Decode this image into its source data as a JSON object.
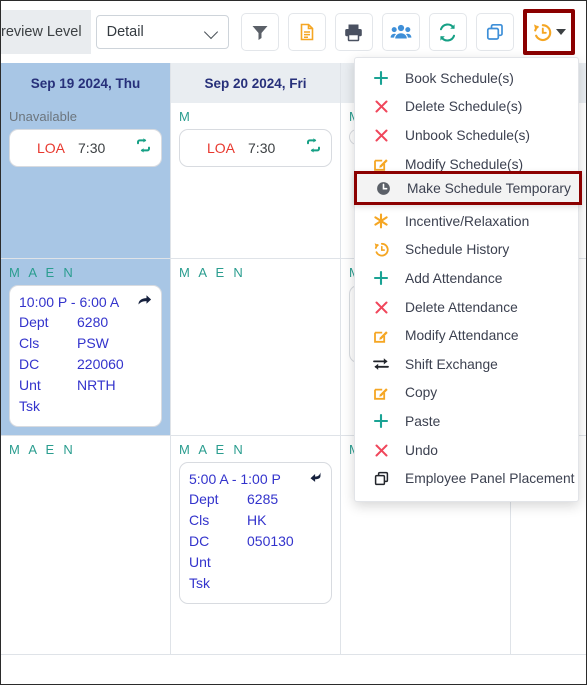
{
  "toolbar": {
    "level_label": "review Level",
    "select_value": "Detail",
    "buttons": [
      {
        "name": "filter-button",
        "icon": "filter-icon"
      },
      {
        "name": "report-button",
        "icon": "document-icon"
      },
      {
        "name": "print-button",
        "icon": "printer-icon"
      },
      {
        "name": "group-button",
        "icon": "people-icon"
      },
      {
        "name": "refresh-button",
        "icon": "refresh-icon"
      },
      {
        "name": "copy-panel-button",
        "icon": "copy-icon"
      },
      {
        "name": "schedule-actions-button",
        "icon": "clock-history-icon"
      }
    ]
  },
  "calendar": {
    "columns": [
      {
        "header": "Sep 19 2024, Thu",
        "selected": true
      },
      {
        "header": "Sep 20 2024, Fri",
        "selected": false
      },
      {
        "header": "",
        "selected": false
      },
      {
        "header": "",
        "selected": false
      }
    ],
    "rows": [
      {
        "cells": [
          {
            "tag": "Unavailable",
            "tag_style": "unavailable",
            "card": {
              "type": "loa",
              "code": "LOA",
              "hours": "7:30",
              "icon": "repeat-icon"
            }
          },
          {
            "tag": "M",
            "tag_style": "shift",
            "card": {
              "type": "loa",
              "code": "LOA",
              "hours": "7:30",
              "icon": "repeat-icon"
            }
          },
          {
            "tag": "M",
            "tag_style": "shift",
            "card": {
              "type": "loa",
              "code": "",
              "hours": "",
              "icon": ""
            }
          },
          {
            "tag": "",
            "tag_style": "shift",
            "card": null
          }
        ]
      },
      {
        "cells": [
          {
            "tag": "M A E N",
            "tag_style": "shift",
            "card": {
              "type": "shift",
              "time": "10:00 P - 6:00 A",
              "icon": "forward-arrow-icon",
              "fields": [
                {
                  "key": "Dept",
                  "value": "6280"
                },
                {
                  "key": "Cls",
                  "value": "PSW"
                },
                {
                  "key": "DC",
                  "value": "220060"
                },
                {
                  "key": "Unt",
                  "value": "NRTH"
                },
                {
                  "key": "Tsk",
                  "value": ""
                }
              ]
            }
          },
          {
            "tag": "M A E N",
            "tag_style": "shift",
            "card": null
          },
          {
            "tag": "M",
            "tag_style": "shift",
            "card": null
          },
          {
            "tag": "",
            "tag_style": "shift",
            "card": null
          }
        ]
      },
      {
        "cells": [
          {
            "tag": "M A E N",
            "tag_style": "shift",
            "card": null
          },
          {
            "tag": "M A E N",
            "tag_style": "shift",
            "card": {
              "type": "shift",
              "time": "5:00 A - 1:00 P",
              "icon": "back-arrow-icon",
              "fields": [
                {
                  "key": "Dept",
                  "value": "6285"
                },
                {
                  "key": "Cls",
                  "value": "HK"
                },
                {
                  "key": "DC",
                  "value": "050130"
                },
                {
                  "key": "Unt",
                  "value": ""
                },
                {
                  "key": "Tsk",
                  "value": ""
                }
              ]
            }
          },
          {
            "tag": "M",
            "tag_style": "shift",
            "card": null
          },
          {
            "tag": "",
            "tag_style": "shift",
            "card": null
          }
        ]
      }
    ]
  },
  "menu": {
    "items": [
      {
        "label": "Book Schedule(s)",
        "icon": "plus-icon",
        "color": "#1aa394"
      },
      {
        "label": "Delete Schedule(s)",
        "icon": "x-icon",
        "color": "#f0465b"
      },
      {
        "label": "Unbook Schedule(s)",
        "icon": "x-icon",
        "color": "#f0465b"
      },
      {
        "label": "Modify Schedule(s)",
        "icon": "edit-square-icon",
        "color": "#f5a623"
      },
      {
        "label": "Make Schedule Temporary",
        "icon": "clock-icon",
        "color": "#5b6068",
        "highlighted": true
      },
      {
        "label": "Incentive/Relaxation",
        "icon": "asterisk-icon",
        "color": "#f5a623"
      },
      {
        "label": "Schedule History",
        "icon": "clock-history-icon",
        "color": "#f5a623"
      },
      {
        "label": "Add Attendance",
        "icon": "plus-icon",
        "color": "#1aa394"
      },
      {
        "label": "Delete Attendance",
        "icon": "x-icon",
        "color": "#f0465b"
      },
      {
        "label": "Modify Attendance",
        "icon": "edit-square-icon",
        "color": "#f5a623"
      },
      {
        "label": "Shift Exchange",
        "icon": "exchange-icon",
        "color": "#22252b"
      },
      {
        "label": "Copy",
        "icon": "edit-square-icon",
        "color": "#f5a623"
      },
      {
        "label": "Paste",
        "icon": "plus-icon",
        "color": "#1aa394"
      },
      {
        "label": "Undo",
        "icon": "x-icon",
        "color": "#f0465b"
      },
      {
        "label": "Employee Panel Placement",
        "icon": "copy-icon",
        "color": "#22252b"
      }
    ]
  },
  "colors": {
    "highlight_border": "#8b0000",
    "selected_column": "#a8c6e5",
    "header_text": "#27307a",
    "shift_text": "#3333cc",
    "tag_teal": "#2a9d8f",
    "loa_red": "#e8392f"
  }
}
